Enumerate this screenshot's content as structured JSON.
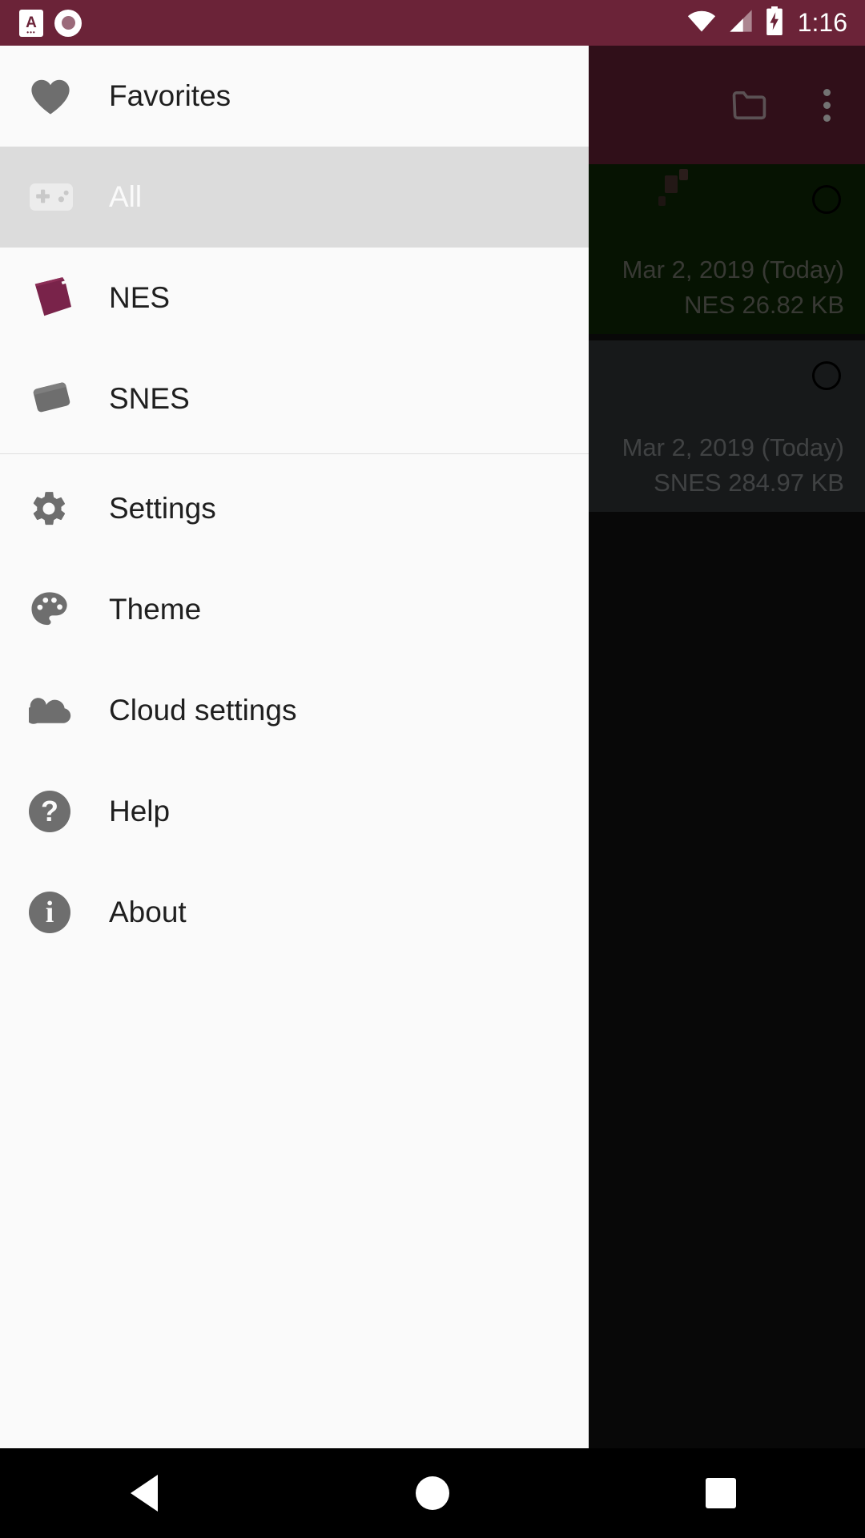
{
  "status_bar": {
    "app_icon_letter": "A",
    "app_icon_dots": "•••",
    "time": "1:16",
    "icons": [
      "wifi-icon",
      "cellular-signal-icon",
      "battery-charging-icon"
    ],
    "background_color": "#6B2338"
  },
  "app_bar": {
    "icons": [
      "folder-icon",
      "overflow-menu-icon"
    ],
    "background_color": "#6B2338"
  },
  "drawer": {
    "background_color": "#FAFAFA",
    "selected_background_color": "#DCDCDC",
    "accent_color": "#6B2338",
    "groups": [
      {
        "items": [
          {
            "label": "Favorites",
            "icon": "heart-icon",
            "selected": false
          },
          {
            "label": "All",
            "icon": "gamepad-icon",
            "selected": true
          },
          {
            "label": "NES",
            "icon": "cartridge-icon",
            "selected": false,
            "icon_color": "#79234A"
          },
          {
            "label": "SNES",
            "icon": "cartridge-icon",
            "selected": false,
            "icon_color": "#6E6E6E"
          }
        ]
      },
      {
        "items": [
          {
            "label": "Settings",
            "icon": "gear-icon",
            "selected": false
          },
          {
            "label": "Theme",
            "icon": "palette-icon",
            "selected": false
          },
          {
            "label": "Cloud settings",
            "icon": "cloud-icon",
            "selected": false
          },
          {
            "label": "Help",
            "icon": "help-circle-icon",
            "selected": false
          },
          {
            "label": "About",
            "icon": "info-circle-icon",
            "selected": false
          }
        ]
      }
    ]
  },
  "game_list": {
    "items": [
      {
        "date": "Mar 2, 2019 (Today)",
        "size_line": "NES 26.82 KB",
        "system": "NES",
        "size": "26.82 KB",
        "thumbnail_color": "#0E2B06",
        "selector": "radio-unchecked-icon"
      },
      {
        "date": "Mar 2, 2019 (Today)",
        "size_line": "SNES 284.97 KB",
        "system": "SNES",
        "size": "284.97 KB",
        "thumbnail_color": "#33393B",
        "selector": "radio-unchecked-icon"
      }
    ]
  },
  "nav_bar": {
    "buttons": [
      {
        "name": "back",
        "icon": "back-triangle-icon"
      },
      {
        "name": "home",
        "icon": "home-circle-icon"
      },
      {
        "name": "recents",
        "icon": "recents-square-icon"
      }
    ],
    "background_color": "#000000"
  }
}
